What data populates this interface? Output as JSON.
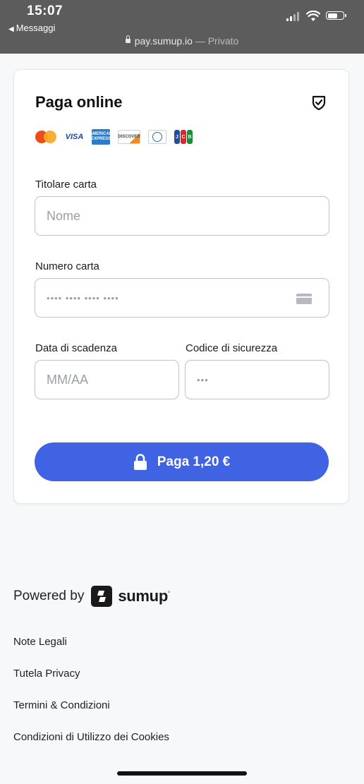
{
  "status_bar": {
    "time": "15:07",
    "back_label": "Messaggi",
    "url": "pay.sumup.io",
    "url_separator": " — ",
    "privacy_mode": "Privato"
  },
  "card": {
    "title": "Paga online",
    "brands": [
      "mastercard-icon",
      "visa-icon",
      "amex-icon",
      "discover-icon",
      "diners-icon",
      "jcb-icon"
    ],
    "brand_texts": {
      "visa": "VISA",
      "amex": "AMERICAN EXPRESS",
      "discover": "DISCOVER",
      "jcb": [
        "J",
        "C",
        "B"
      ]
    },
    "holder_label": "Titolare carta",
    "holder_placeholder": "Nome",
    "number_label": "Numero carta",
    "number_placeholder": "•••• •••• •••• ••••",
    "expiry_label": "Data di scadenza",
    "expiry_placeholder": "MM/AA",
    "cvv_label": "Codice di sicurezza",
    "cvv_placeholder": "•••",
    "pay_button_label": "Paga 1,20 €"
  },
  "footer": {
    "powered_by": "Powered by",
    "brand_name": "sumup",
    "brand_mark": "°",
    "links": [
      "Note Legali",
      "Tutela Privacy",
      "Termini & Condizioni",
      "Condizioni di Utilizzo dei Cookies"
    ]
  },
  "colors": {
    "accent": "#3f63e2",
    "status_bar": "#5c5c5c",
    "page_bg": "#f7f8fa"
  }
}
